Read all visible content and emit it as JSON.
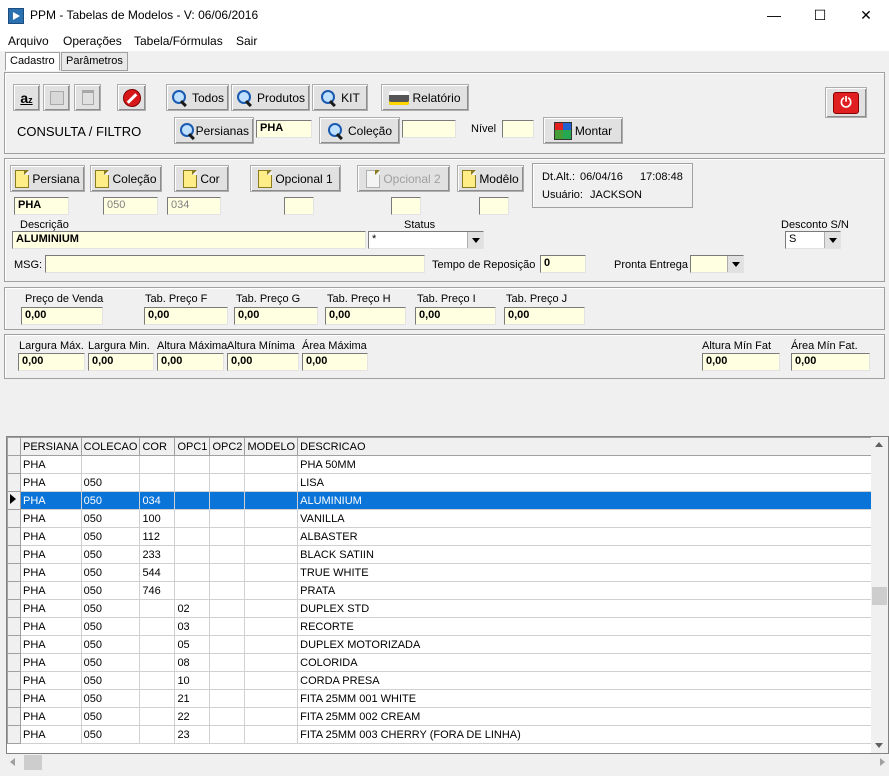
{
  "window": {
    "title": "PPM - Tabelas de Modelos - V: 06/06/2016",
    "minimize": "—",
    "maximize": "☐",
    "close": "✕"
  },
  "menu": [
    "Arquivo",
    "Operações",
    "Tabela/Fórmulas",
    "Sair"
  ],
  "tabs": [
    "Cadastro",
    "Parâmetros"
  ],
  "toolbar": {
    "todos": "Todos",
    "produtos": "Produtos",
    "kit": "KIT",
    "relatorio": "Relatório",
    "consulta_label": "CONSULTA / FILTRO",
    "persianas": "Persianas",
    "persianas_value": "PHA",
    "colecao": "Coleção",
    "colecao_value": "",
    "nivel_label": "Nível",
    "nivel_value": "",
    "montar": "Montar"
  },
  "record": {
    "persiana_btn": "Persiana",
    "colecao_btn": "Coleção",
    "cor_btn": "Cor",
    "opcional1_btn": "Opcional 1",
    "opcional2_btn": "Opcional 2",
    "modelo_btn": "Modêlo",
    "persiana_value": "PHA",
    "colecao_value": "050",
    "cor_value": "034",
    "opcional1_value": "",
    "opcional2_value": "",
    "modelo_value": "",
    "dtalt_label": "Dt.Alt.:",
    "dtalt_date": "06/04/16",
    "dtalt_time": "17:08:48",
    "usuario_label": "Usuário:",
    "usuario_value": "JACKSON",
    "descricao_label": "Descrição",
    "descricao_value": "ALUMINIUM",
    "status_label": "Status",
    "status_value": "*",
    "desconto_label": "Desconto S/N",
    "desconto_value": "S",
    "msg_label": "MSG:",
    "msg_value": "",
    "tempo_label": "Tempo de Reposição",
    "tempo_value": "0",
    "pronta_label": "Pronta Entrega",
    "pronta_value": ""
  },
  "prices": [
    {
      "label": "Preço de Venda",
      "value": "0,00"
    },
    {
      "label": "Tab. Preço F",
      "value": "0,00"
    },
    {
      "label": "Tab. Preço G",
      "value": "0,00"
    },
    {
      "label": "Tab. Preço H",
      "value": "0,00"
    },
    {
      "label": "Tab. Preço I",
      "value": "0,00"
    },
    {
      "label": "Tab. Preço J",
      "value": "0,00"
    }
  ],
  "dims": [
    {
      "label": "Largura Máx.",
      "value": "0,00"
    },
    {
      "label": "Largura Min.",
      "value": "0,00"
    },
    {
      "label": "Altura Máxima",
      "value": "0,00"
    },
    {
      "label": "Altura Mínima",
      "value": "0,00"
    },
    {
      "label": "Área Máxima",
      "value": "0,00"
    },
    {
      "label": "Altura Mín Fat",
      "value": "0,00"
    },
    {
      "label": "Área Mín Fat.",
      "value": "0,00"
    }
  ],
  "grid": {
    "columns": [
      "PERSIANA",
      "COLECAO",
      "COR",
      "OPC1",
      "OPC2",
      "MODELO",
      "DESCRICAO"
    ],
    "rows": [
      [
        "PHA",
        "",
        "",
        "",
        "",
        "",
        "PHA 50MM"
      ],
      [
        "PHA",
        "050",
        "",
        "",
        "",
        "",
        "LISA"
      ],
      [
        "PHA",
        "050",
        "034",
        "",
        "",
        "",
        "ALUMINIUM"
      ],
      [
        "PHA",
        "050",
        "100",
        "",
        "",
        "",
        "VANILLA"
      ],
      [
        "PHA",
        "050",
        "112",
        "",
        "",
        "",
        "ALBASTER"
      ],
      [
        "PHA",
        "050",
        "233",
        "",
        "",
        "",
        "BLACK SATIIN"
      ],
      [
        "PHA",
        "050",
        "544",
        "",
        "",
        "",
        "TRUE WHITE"
      ],
      [
        "PHA",
        "050",
        "746",
        "",
        "",
        "",
        "PRATA"
      ],
      [
        "PHA",
        "050",
        "",
        "02",
        "",
        "",
        "DUPLEX STD"
      ],
      [
        "PHA",
        "050",
        "",
        "03",
        "",
        "",
        "RECORTE"
      ],
      [
        "PHA",
        "050",
        "",
        "05",
        "",
        "",
        "DUPLEX MOTORIZADA"
      ],
      [
        "PHA",
        "050",
        "",
        "08",
        "",
        "",
        "COLORIDA"
      ],
      [
        "PHA",
        "050",
        "",
        "10",
        "",
        "",
        "CORDA PRESA"
      ],
      [
        "PHA",
        "050",
        "",
        "21",
        "",
        "",
        "FITA 25MM 001 WHITE"
      ],
      [
        "PHA",
        "050",
        "",
        "22",
        "",
        "",
        "FITA 25MM 002 CREAM"
      ],
      [
        "PHA",
        "050",
        "",
        "23",
        "",
        "",
        "FITA 25MM 003 CHERRY (FORA DE LINHA)"
      ]
    ],
    "selected_row": 2
  }
}
